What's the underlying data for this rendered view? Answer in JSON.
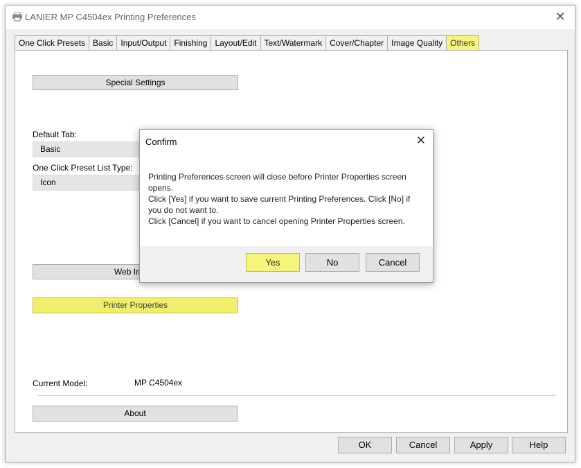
{
  "window": {
    "title": "LANIER MP C4504ex Printing Preferences",
    "close_glyph": "✕"
  },
  "tabs": [
    {
      "label": "One Click Presets"
    },
    {
      "label": "Basic"
    },
    {
      "label": "Input/Output"
    },
    {
      "label": "Finishing"
    },
    {
      "label": "Layout/Edit"
    },
    {
      "label": "Text/Watermark"
    },
    {
      "label": "Cover/Chapter"
    },
    {
      "label": "Image Quality"
    },
    {
      "label": "Others",
      "highlighted": true
    }
  ],
  "panel": {
    "special_settings_label": "Special Settings",
    "default_tab_label": "Default Tab:",
    "default_tab_value": "Basic",
    "preset_list_type_label": "One Click Preset List Type:",
    "preset_list_type_value": "Icon",
    "web_image_label": "Web Image",
    "printer_properties_label": "Printer Properties",
    "current_model_label": "Current Model:",
    "current_model_value": "MP C4504ex",
    "about_label": "About"
  },
  "footer": {
    "ok_label": "OK",
    "cancel_label": "Cancel",
    "apply_label": "Apply",
    "help_label": "Help"
  },
  "dialog": {
    "title": "Confirm",
    "close_glyph": "✕",
    "message_lines": [
      "Printing Preferences screen will close before Printer Properties screen",
      "opens.",
      "Click [Yes] if you want to save current Printing Preferences. Click [No] if",
      "you do not want to.",
      "Click [Cancel] if you want to cancel opening Printer Properties screen."
    ],
    "yes_label": "Yes",
    "no_label": "No",
    "cancel_label": "Cancel"
  },
  "colors": {
    "highlight": "#f6f47a",
    "window_bg": "#f0f0f0",
    "button_bg": "#e1e1e1"
  }
}
